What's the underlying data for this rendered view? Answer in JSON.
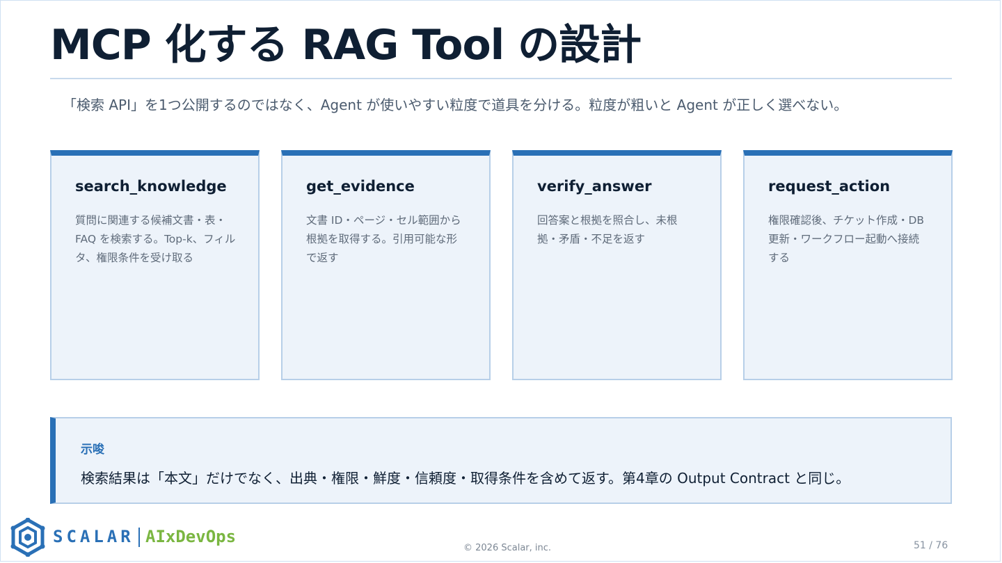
{
  "slide": {
    "title": "MCP 化する RAG Tool の設計",
    "subtitle": "「検索 API」を1つ公開するのではなく、Agent が使いやすい粒度で道具を分ける。粒度が粗いと Agent が正しく選べない。"
  },
  "cards": [
    {
      "title": "search_knowledge",
      "desc": "質問に関連する候補文書・表・FAQ を検索する。Top-k、フィルタ、権限条件を受け取る"
    },
    {
      "title": "get_evidence",
      "desc": "文書 ID・ページ・セル範囲から根拠を取得する。引用可能な形で返す"
    },
    {
      "title": "verify_answer",
      "desc": "回答案と根拠を照合し、未根拠・矛盾・不足を返す"
    },
    {
      "title": "request_action",
      "desc": "権限確認後、チケット作成・DB 更新・ワークフロー起動へ接続する"
    }
  ],
  "note": {
    "label": "示唆",
    "text": "検索結果は「本文」だけでなく、出典・権限・鮮度・信頼度・取得条件を含めて返す。第4章の Output Contract と同じ。"
  },
  "footer": {
    "brand": "SCALAR",
    "brand_sub": "AIxDevOps",
    "copyright": "© 2026 Scalar, inc.",
    "page": "51 / 76",
    "logo_icon": "scalar-logo-icon"
  },
  "colors": {
    "accent": "#2a70b6",
    "card_bg": "#edf3fa",
    "brand_green": "#7ab641"
  }
}
